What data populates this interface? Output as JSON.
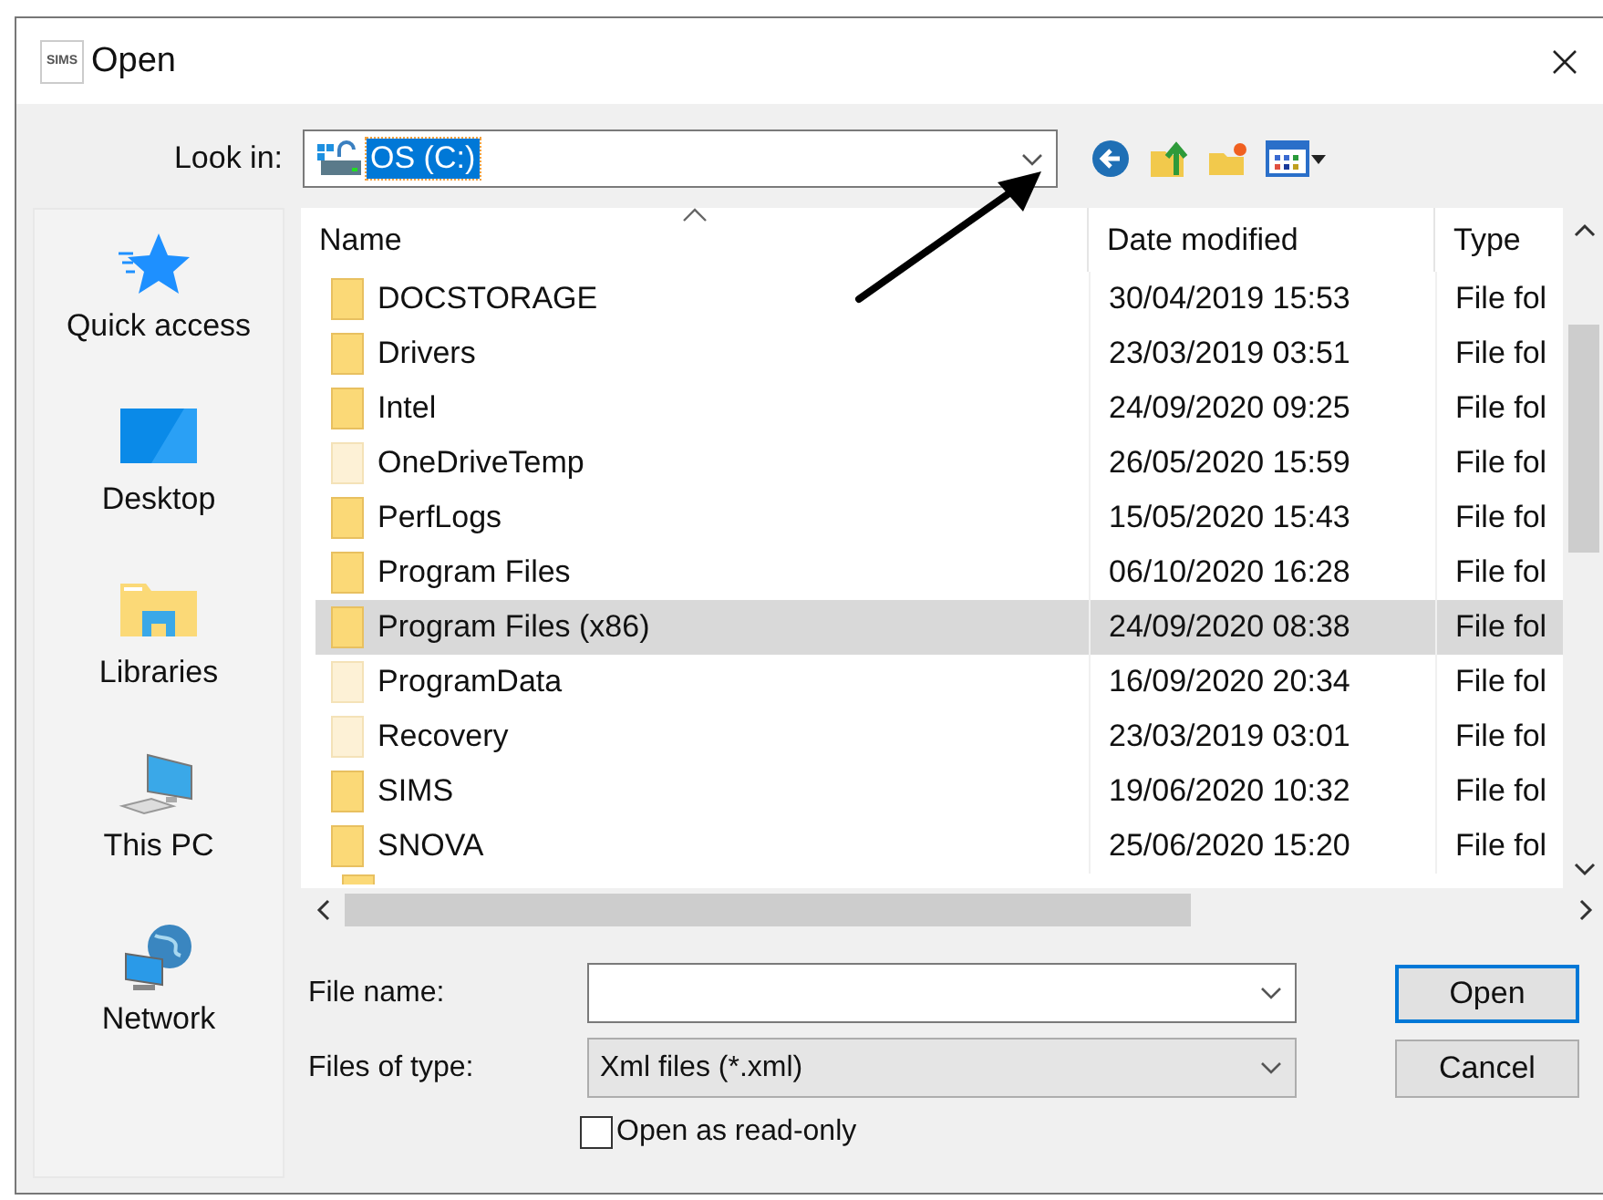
{
  "window": {
    "title": "Open",
    "app_badge": "SIMS"
  },
  "look_in": {
    "label": "Look in:",
    "value": "OS (C:)"
  },
  "sidebar": {
    "items": [
      {
        "label": "Quick access",
        "kind": "star"
      },
      {
        "label": "Desktop",
        "kind": "desktop"
      },
      {
        "label": "Libraries",
        "kind": "libraries"
      },
      {
        "label": "This PC",
        "kind": "pc"
      },
      {
        "label": "Network",
        "kind": "network"
      }
    ]
  },
  "table": {
    "columns": [
      "Name",
      "Date modified",
      "Type"
    ],
    "rows": [
      {
        "name": "DOCSTORAGE",
        "date": "30/04/2019 15:53",
        "type": "File fol",
        "hidden": false,
        "selected": false
      },
      {
        "name": "Drivers",
        "date": "23/03/2019 03:51",
        "type": "File fol",
        "hidden": false,
        "selected": false
      },
      {
        "name": "Intel",
        "date": "24/09/2020 09:25",
        "type": "File fol",
        "hidden": false,
        "selected": false
      },
      {
        "name": "OneDriveTemp",
        "date": "26/05/2020 15:59",
        "type": "File fol",
        "hidden": true,
        "selected": false
      },
      {
        "name": "PerfLogs",
        "date": "15/05/2020 15:43",
        "type": "File fol",
        "hidden": false,
        "selected": false
      },
      {
        "name": "Program Files",
        "date": "06/10/2020 16:28",
        "type": "File fol",
        "hidden": false,
        "selected": false
      },
      {
        "name": "Program Files (x86)",
        "date": "24/09/2020 08:38",
        "type": "File fol",
        "hidden": false,
        "selected": true
      },
      {
        "name": "ProgramData",
        "date": "16/09/2020 20:34",
        "type": "File fol",
        "hidden": true,
        "selected": false
      },
      {
        "name": "Recovery",
        "date": "23/03/2019 03:01",
        "type": "File fol",
        "hidden": true,
        "selected": false
      },
      {
        "name": "SIMS",
        "date": "19/06/2020 10:32",
        "type": "File fol",
        "hidden": false,
        "selected": false
      },
      {
        "name": "SNOVA",
        "date": "25/06/2020 15:20",
        "type": "File fol",
        "hidden": false,
        "selected": false
      }
    ]
  },
  "file_name": {
    "label": "File name:"
  },
  "file_type": {
    "label": "Files of type:",
    "value": "Xml files (*.xml)"
  },
  "read_only": {
    "label": "Open as read-only",
    "checked": false
  },
  "buttons": [
    "Open",
    "Cancel"
  ]
}
